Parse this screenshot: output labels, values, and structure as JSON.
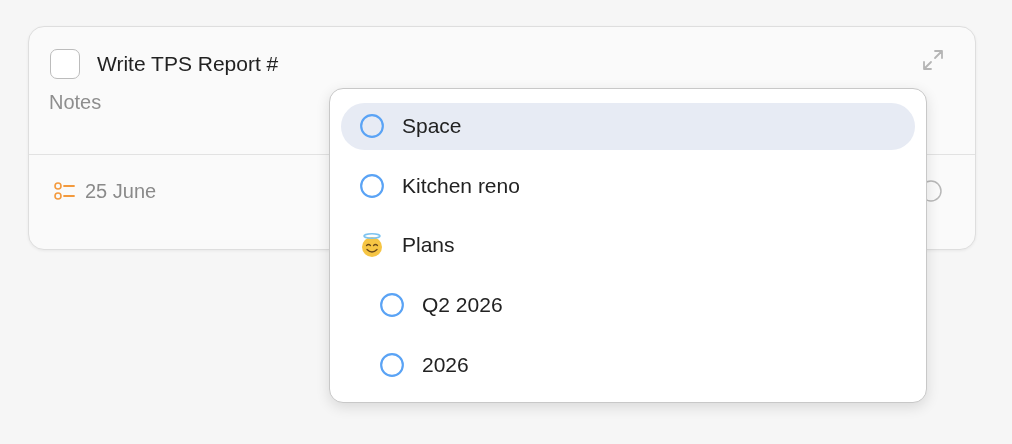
{
  "task": {
    "checked": false,
    "title": "Write TPS Report #",
    "notes": {
      "placeholder": "Notes"
    },
    "date": "25 June"
  },
  "menu": {
    "items": [
      {
        "label": "Space",
        "kind": "project",
        "selected": true
      },
      {
        "label": "Kitchen reno",
        "kind": "project",
        "selected": false
      },
      {
        "label": "Plans",
        "kind": "area",
        "selected": false,
        "children": [
          {
            "label": "Q2 2026",
            "kind": "project",
            "selected": false
          },
          {
            "label": "2026",
            "kind": "project",
            "selected": false
          }
        ]
      }
    ]
  }
}
